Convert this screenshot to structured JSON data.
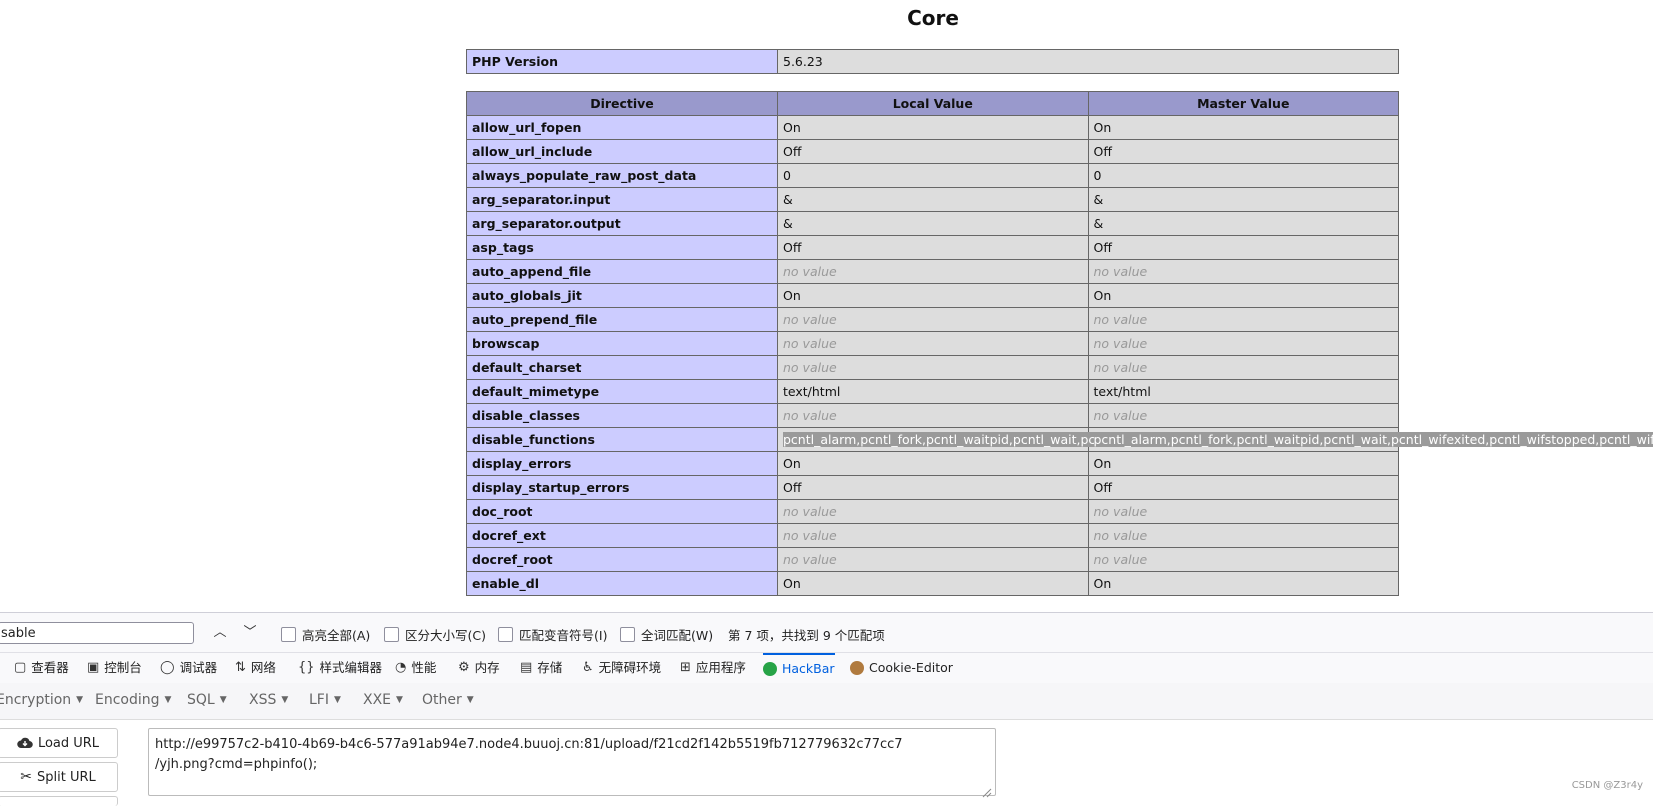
{
  "php_page": {
    "title": "Core",
    "version_label": "PHP Version",
    "version_value": "5.6.23",
    "headers": [
      "Directive",
      "Local Value",
      "Master Value"
    ],
    "rows": [
      {
        "name": "allow_url_fopen",
        "local": "On",
        "master": "On"
      },
      {
        "name": "allow_url_include",
        "local": "Off",
        "master": "Off"
      },
      {
        "name": "always_populate_raw_post_data",
        "local": "0",
        "master": "0"
      },
      {
        "name": "arg_separator.input",
        "local": "&",
        "master": "&"
      },
      {
        "name": "arg_separator.output",
        "local": "&",
        "master": "&"
      },
      {
        "name": "asp_tags",
        "local": "Off",
        "master": "Off"
      },
      {
        "name": "auto_append_file",
        "local": "no value",
        "master": "no value",
        "novalue": true
      },
      {
        "name": "auto_globals_jit",
        "local": "On",
        "master": "On"
      },
      {
        "name": "auto_prepend_file",
        "local": "no value",
        "master": "no value",
        "novalue": true
      },
      {
        "name": "browscap",
        "local": "no value",
        "master": "no value",
        "novalue": true
      },
      {
        "name": "default_charset",
        "local": "no value",
        "master": "no value",
        "novalue": true
      },
      {
        "name": "default_mimetype",
        "local": "text/html",
        "master": "text/html"
      },
      {
        "name": "disable_classes",
        "local": "no value",
        "master": "no value",
        "novalue": true
      },
      {
        "name": "disable_functions",
        "local": "pcntl_alarm,pcntl_fork,pcntl_waitpid,pcntl_wait,pcntl_w",
        "master": "pcntl_alarm,pcntl_fork,pcntl_waitpid,pcntl_wait,pcntl_wifexited,pcntl_wifstopped,pcntl_wifsignaled",
        "highlight": true
      },
      {
        "name": "display_errors",
        "local": "On",
        "master": "On"
      },
      {
        "name": "display_startup_errors",
        "local": "Off",
        "master": "Off"
      },
      {
        "name": "doc_root",
        "local": "no value",
        "master": "no value",
        "novalue": true
      },
      {
        "name": "docref_ext",
        "local": "no value",
        "master": "no value",
        "novalue": true
      },
      {
        "name": "docref_root",
        "local": "no value",
        "master": "no value",
        "novalue": true
      },
      {
        "name": "enable_dl",
        "local": "On",
        "master": "On"
      }
    ]
  },
  "findbar": {
    "query": "sable",
    "prev_icon": "chevron-up",
    "next_icon": "chevron-down",
    "options": [
      "高亮全部(A)",
      "区分大小写(C)",
      "匹配变音符号(I)",
      "全词匹配(W)"
    ],
    "status": "第 7 项，共找到 9 个匹配项"
  },
  "devtools": {
    "tabs": [
      {
        "label": "查看器",
        "icon": "▢"
      },
      {
        "label": "控制台",
        "icon": "▣"
      },
      {
        "label": "调试器",
        "icon": "◯"
      },
      {
        "label": "网络",
        "icon": "⇅"
      },
      {
        "label": "样式编辑器",
        "icon": "{}"
      },
      {
        "label": "性能",
        "icon": "◔"
      },
      {
        "label": "内存",
        "icon": "⚙"
      },
      {
        "label": "存储",
        "icon": "▤"
      },
      {
        "label": "无障碍环境",
        "icon": "♿"
      },
      {
        "label": "应用程序",
        "icon": "⊞"
      },
      {
        "label": "HackBar",
        "icon": "hackbar",
        "active": true
      },
      {
        "label": "Cookie-Editor",
        "icon": "cookie"
      }
    ]
  },
  "hackbar": {
    "menus": [
      "Encryption",
      "Encoding",
      "SQL",
      "XSS",
      "LFI",
      "XXE",
      "Other"
    ],
    "load_url": "Load URL",
    "split_url": "Split URL",
    "url_text": "http://e99757c2-b410-4b69-b4c6-577a91ab94e7.node4.buuoj.cn:81/upload/f21cd2f142b5519fb712779632c77cc7\n/yjh.png?cmd=phpinfo();"
  },
  "watermark": "CSDN @Z3r4y",
  "colors": {
    "header": "#9999cc",
    "directive": "#ccccff",
    "value": "#dddddd",
    "accent": "#0060df"
  }
}
